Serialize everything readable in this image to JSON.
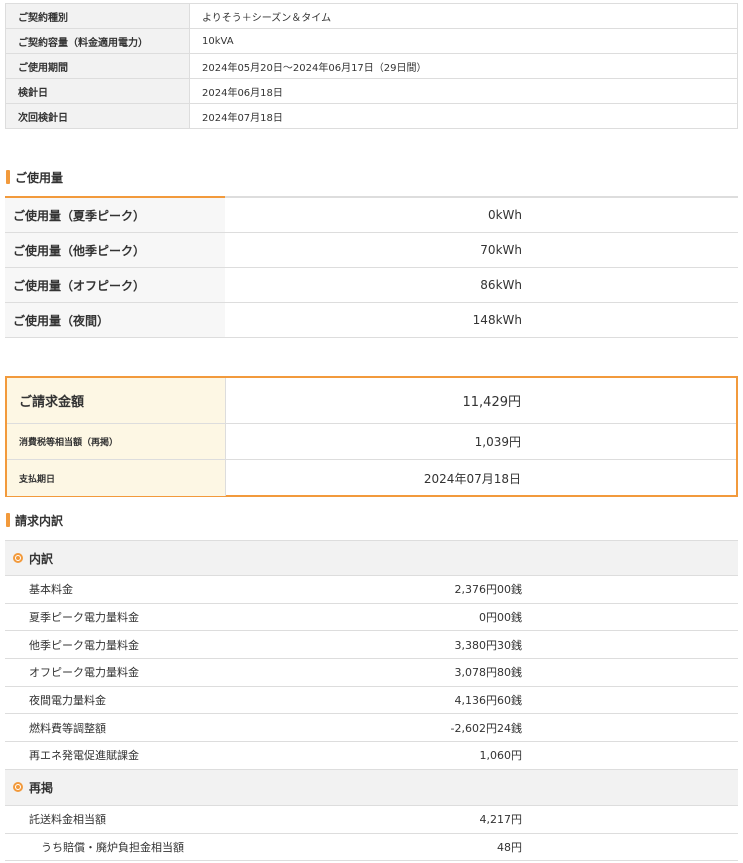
{
  "contract": {
    "rows": [
      {
        "label": "ご契約種別",
        "value": "よりそう＋シーズン＆タイム"
      },
      {
        "label": "ご契約容量（料金適用電力）",
        "value": "10kVA"
      },
      {
        "label": "ご使用期間",
        "value": "2024年05月20日～2024年06月17日（29日間）"
      },
      {
        "label": "検針日",
        "value": "2024年06月18日"
      },
      {
        "label": "次回検針日",
        "value": "2024年07月18日"
      }
    ]
  },
  "usage": {
    "title": "ご使用量",
    "rows": [
      {
        "label": "ご使用量（夏季ピーク）",
        "value": "0kWh"
      },
      {
        "label": "ご使用量（他季ピーク）",
        "value": "70kWh"
      },
      {
        "label": "ご使用量（オフピーク）",
        "value": "86kWh"
      },
      {
        "label": "ご使用量（夜間）",
        "value": "148kWh"
      }
    ]
  },
  "billing": {
    "amount_label": "ご請求金額",
    "amount_value": "11,429円",
    "tax_label": "消費税等相当額（再掲）",
    "tax_value": "1,039円",
    "due_label": "支払期日",
    "due_value": "2024年07月18日"
  },
  "detail": {
    "title": "請求内訳",
    "group1": "内訳",
    "items": [
      {
        "label": "基本料金",
        "value": "2,376円00銭"
      },
      {
        "label": "夏季ピーク電力量料金",
        "value": "0円00銭"
      },
      {
        "label": "他季ピーク電力量料金",
        "value": "3,380円30銭"
      },
      {
        "label": "オフピーク電力量料金",
        "value": "3,078円80銭"
      },
      {
        "label": "夜間電力量料金",
        "value": "4,136円60銭"
      },
      {
        "label": "燃料費等調整額",
        "value": "-2,602円24銭"
      },
      {
        "label": "再エネ発電促進賦課金",
        "value": "1,060円"
      }
    ],
    "group2": "再掲",
    "items2": [
      {
        "label": "託送料金相当額",
        "value": "4,217円"
      },
      {
        "label": "うち賠償・廃炉負担金相当額",
        "value": "48円"
      }
    ]
  },
  "colors": {
    "accent": "#f29a3c",
    "label_bg": "#f2f2f2",
    "billing_label_bg": "#fdf7e4"
  }
}
